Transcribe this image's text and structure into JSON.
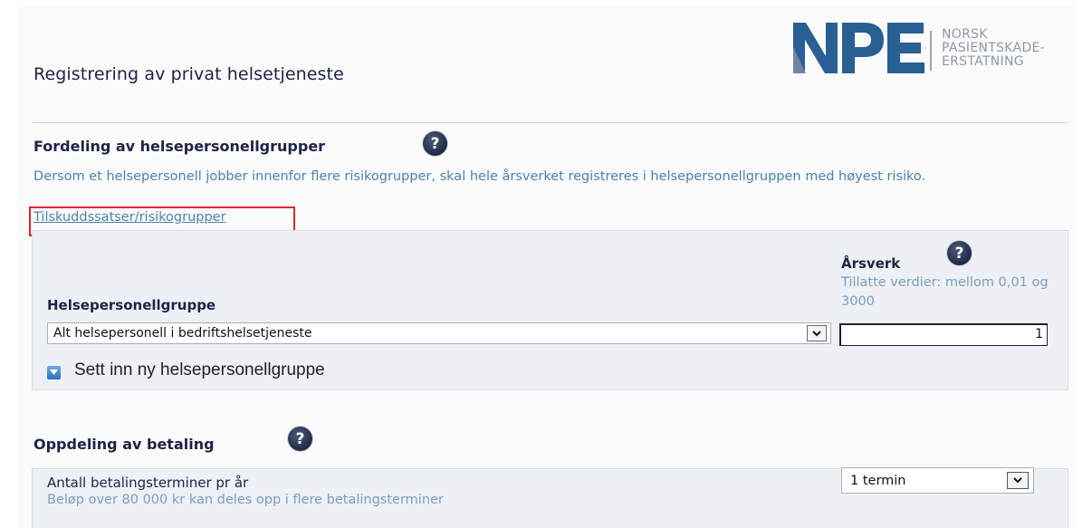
{
  "page": {
    "title": "Registrering av privat helsetjeneste"
  },
  "logo": {
    "mark": "NPE",
    "lines": [
      "NORSK",
      "PASIENTSKADE-",
      "ERSTATNING"
    ]
  },
  "fordeling": {
    "heading": "Fordeling av helsepersonellgrupper",
    "description": "Dersom et helsepersonell jobber innenfor flere risikogrupper, skal hele årsverket registreres i helsepersonellgruppen med høyest risiko.",
    "link": "Tilskuddssatser/risikogrupper",
    "help_icon": "question-mark-icon",
    "highlight_color": "#e3242b"
  },
  "form": {
    "group_label": "Helsepersonellgruppe",
    "group_value": "Alt helsepersonell i bedriftshelsetjeneste",
    "arsverk_label": "Årsverk",
    "arsverk_hint": "Tillatte verdier: mellom 0,01 og 3000",
    "arsverk_value": "1",
    "add_label": "Sett inn ny helsepersonellgruppe"
  },
  "betaling": {
    "heading": "Oppdeling av betaling",
    "label": "Antall betalingsterminer pr år",
    "hint": "Beløp over 80 000 kr kan deles opp i flere betalingsterminer",
    "select_value": "1 termin"
  },
  "colors": {
    "heading": "#1e2346",
    "link": "#4a83ad",
    "panel": "#edf0f5",
    "brand": "#2a5f95"
  }
}
